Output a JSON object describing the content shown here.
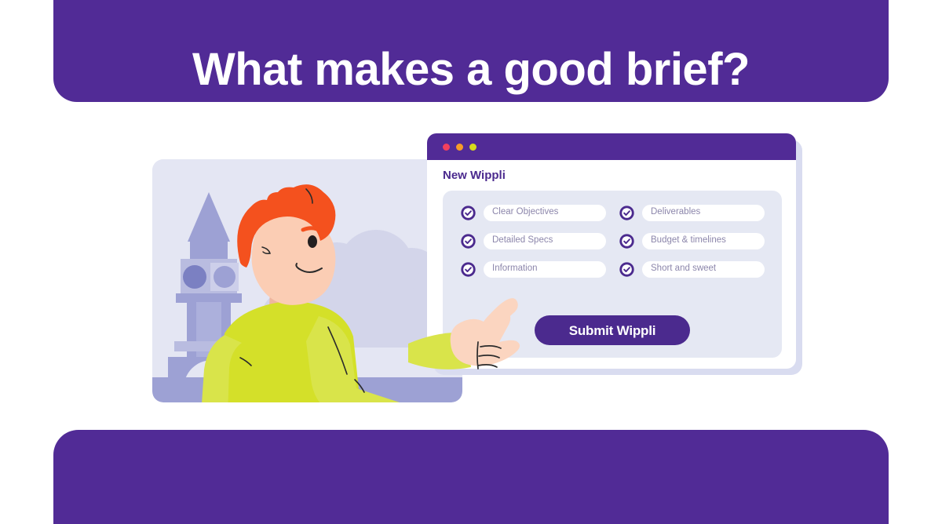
{
  "banner": {
    "title": "What makes a good brief?",
    "purple": "#512B96"
  },
  "browser": {
    "traffic_lights": [
      {
        "name": "close-dot",
        "color": "#F2405D"
      },
      {
        "name": "minimize-dot",
        "color": "#F79C28"
      },
      {
        "name": "maximize-dot",
        "color": "#D6DB1C"
      }
    ],
    "heading": "New Wippli",
    "fields": [
      {
        "label": "Clear Objectives",
        "checked": true
      },
      {
        "label": "Deliverables",
        "checked": true
      },
      {
        "label": "Detailed Specs",
        "checked": true
      },
      {
        "label": "Budget & timelines",
        "checked": true
      },
      {
        "label": "Information",
        "checked": true
      },
      {
        "label": "Short and sweet",
        "checked": true
      }
    ],
    "submit_label": "Submit Wippli",
    "accent": "#4B2A8E",
    "panel_bg": "#E5E8F3",
    "field_text_color": "#8C86AB"
  },
  "illustration": {
    "name": "person-pointing-at-form-with-big-ben-background",
    "background": "#E4E6F3",
    "hair_color": "#F4511E",
    "skin_color": "#FBCDB4",
    "sweater_color": "#D4E029",
    "landmark": "big-ben",
    "landmark_color": "#8C90CB"
  }
}
